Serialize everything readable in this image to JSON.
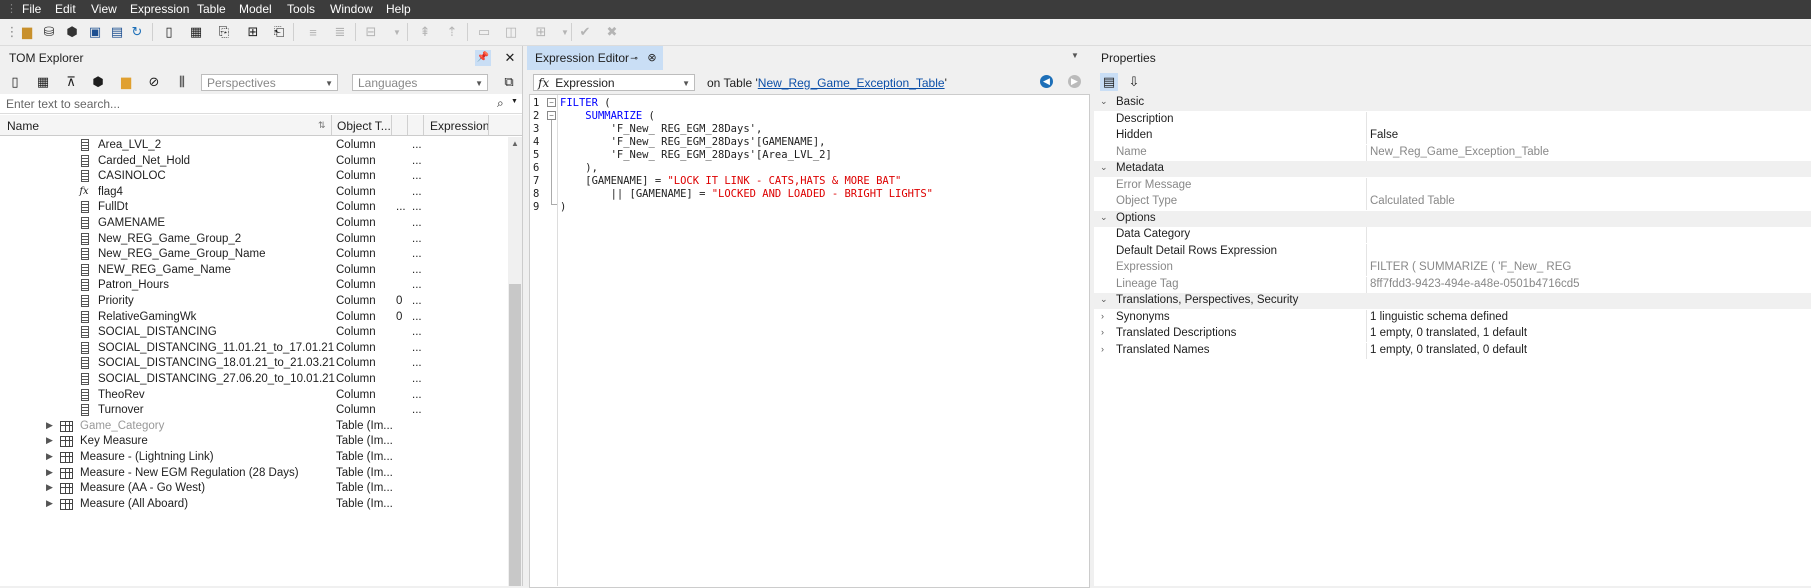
{
  "menu": [
    "File",
    "Edit",
    "View",
    "Expression",
    "Table",
    "Model",
    "Tools",
    "Window",
    "Help"
  ],
  "tom": {
    "title": "TOM Explorer",
    "perspectives": "Perspectives",
    "languages": "Languages",
    "search_placeholder": "Enter text to search...",
    "columns": [
      "Name",
      "Object T...",
      "Expression"
    ],
    "rows": [
      {
        "name": "Area_LVL_2",
        "type": "Column",
        "c3": "",
        "c4": "...",
        "kind": "col"
      },
      {
        "name": "Carded_Net_Hold",
        "type": "Column",
        "c3": "",
        "c4": "...",
        "kind": "col"
      },
      {
        "name": "CASINOLOC",
        "type": "Column",
        "c3": "",
        "c4": "...",
        "kind": "col"
      },
      {
        "name": "flag4",
        "type": "Column",
        "c3": "",
        "c4": "...",
        "kind": "fx"
      },
      {
        "name": "FullDt",
        "type": "Column",
        "c3": "...",
        "c4": "...",
        "kind": "col"
      },
      {
        "name": "GAMENAME",
        "type": "Column",
        "c3": "",
        "c4": "...",
        "kind": "col"
      },
      {
        "name": "New_REG_Game_Group_2",
        "type": "Column",
        "c3": "",
        "c4": "...",
        "kind": "col"
      },
      {
        "name": "New_REG_Game_Group_Name",
        "type": "Column",
        "c3": "",
        "c4": "...",
        "kind": "col"
      },
      {
        "name": "NEW_REG_Game_Name",
        "type": "Column",
        "c3": "",
        "c4": "...",
        "kind": "col"
      },
      {
        "name": "Patron_Hours",
        "type": "Column",
        "c3": "",
        "c4": "...",
        "kind": "col"
      },
      {
        "name": "Priority",
        "type": "Column",
        "c3": "0",
        "c4": "...",
        "kind": "col"
      },
      {
        "name": "RelativeGamingWk",
        "type": "Column",
        "c3": "0",
        "c4": "...",
        "kind": "col"
      },
      {
        "name": "SOCIAL_DISTANCING",
        "type": "Column",
        "c3": "",
        "c4": "...",
        "kind": "col"
      },
      {
        "name": "SOCIAL_DISTANCING_11.01.21_to_17.01.21",
        "type": "Column",
        "c3": "",
        "c4": "...",
        "kind": "col"
      },
      {
        "name": "SOCIAL_DISTANCING_18.01.21_to_21.03.21",
        "type": "Column",
        "c3": "",
        "c4": "...",
        "kind": "col"
      },
      {
        "name": "SOCIAL_DISTANCING_27.06.20_to_10.01.21",
        "type": "Column",
        "c3": "",
        "c4": "...",
        "kind": "col"
      },
      {
        "name": "TheoRev",
        "type": "Column",
        "c3": "",
        "c4": "...",
        "kind": "col"
      },
      {
        "name": "Turnover",
        "type": "Column",
        "c3": "",
        "c4": "...",
        "kind": "col"
      },
      {
        "name": "Game_Category",
        "type": "Table (Im...",
        "c3": "",
        "c4": "",
        "kind": "tbl",
        "gray": true
      },
      {
        "name": "Key Measure",
        "type": "Table (Im...",
        "c3": "",
        "c4": "",
        "kind": "tbl"
      },
      {
        "name": "Measure - (Lightning Link)",
        "type": "Table (Im...",
        "c3": "",
        "c4": "",
        "kind": "tbl"
      },
      {
        "name": "Measure - New EGM Regulation (28 Days)",
        "type": "Table (Im...",
        "c3": "",
        "c4": "",
        "kind": "tbl"
      },
      {
        "name": "Measure (AA - Go West)",
        "type": "Table (Im...",
        "c3": "",
        "c4": "",
        "kind": "tbl"
      },
      {
        "name": "Measure (All Aboard)",
        "type": "Table (Im...",
        "c3": "",
        "c4": "",
        "kind": "tbl"
      }
    ]
  },
  "editor": {
    "tab_title": "Expression Editor",
    "property_select": "Expression",
    "on_table_prefix": "on Table '",
    "on_table_name": "New_Reg_Game_Exception_Table",
    "on_table_suffix": "'",
    "line_numbers": [
      "1",
      "2",
      "3",
      "4",
      "5",
      "6",
      "7",
      "8",
      "9"
    ]
  },
  "properties": {
    "title": "Properties",
    "rows": [
      {
        "cat": true,
        "key": "Basic"
      },
      {
        "key": "Description",
        "value": ""
      },
      {
        "key": "Hidden",
        "value": "False"
      },
      {
        "key": "Name",
        "value": "New_Reg_Game_Exception_Table",
        "dim": true
      },
      {
        "cat": true,
        "key": "Metadata"
      },
      {
        "key": "Error Message",
        "value": "",
        "dim": true
      },
      {
        "key": "Object Type",
        "value": "Calculated Table",
        "dim": true
      },
      {
        "cat": true,
        "key": "Options"
      },
      {
        "key": "Data Category",
        "value": ""
      },
      {
        "key": "Default Detail Rows Expression",
        "value": ""
      },
      {
        "key": "Expression",
        "value": "FILTER (    SUMMARIZE (        'F_New_ REG",
        "dim": true
      },
      {
        "key": "Lineage Tag",
        "value": "8ff7fdd3-9423-494e-a48e-0501b4716cd5",
        "dim": true
      },
      {
        "cat": true,
        "key": "Translations, Perspectives, Security"
      },
      {
        "key": "Synonyms",
        "value": "1 linguistic schema defined",
        "exp": true
      },
      {
        "key": "Translated Descriptions",
        "value": "1 empty, 0 translated, 1 default",
        "exp": true
      },
      {
        "key": "Translated Names",
        "value": "1 empty, 0 translated, 0 default",
        "exp": true
      }
    ]
  }
}
